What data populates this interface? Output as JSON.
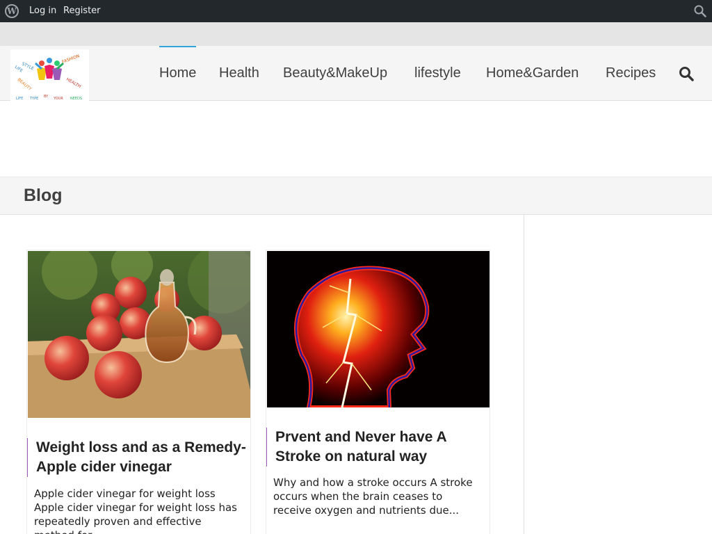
{
  "adminbar": {
    "login_label": "Log in",
    "register_label": "Register"
  },
  "logo": {
    "words": [
      "LIFE",
      "STYLE",
      "FASHION",
      "BEAUTY",
      "HEALTH",
      "LIFE",
      "TYPE",
      "BY",
      "YOUR",
      "NEEDS"
    ]
  },
  "nav": {
    "items": [
      "Home",
      "Health",
      "Beauty&MakeUp",
      "lifestyle",
      "Home&Garden",
      "Recipes"
    ],
    "active_index": 0
  },
  "page": {
    "title": "Blog"
  },
  "posts": [
    {
      "title": "Weight loss and as a Remedy-Apple cider vinegar",
      "excerpt": "Apple cider vinegar for weight loss Apple cider vinegar for weight loss has repeatedly proven and effective method for..."
    },
    {
      "title": "Prvent and Never have A Stroke on natural way",
      "excerpt": "Why and how a stroke occurs A stroke occurs when the brain ceases to receive oxygen and nutrients due..."
    }
  ],
  "colors": {
    "adminbar": "#23282d",
    "accent": "#31a3dd",
    "title_border": "#9b59b6"
  }
}
